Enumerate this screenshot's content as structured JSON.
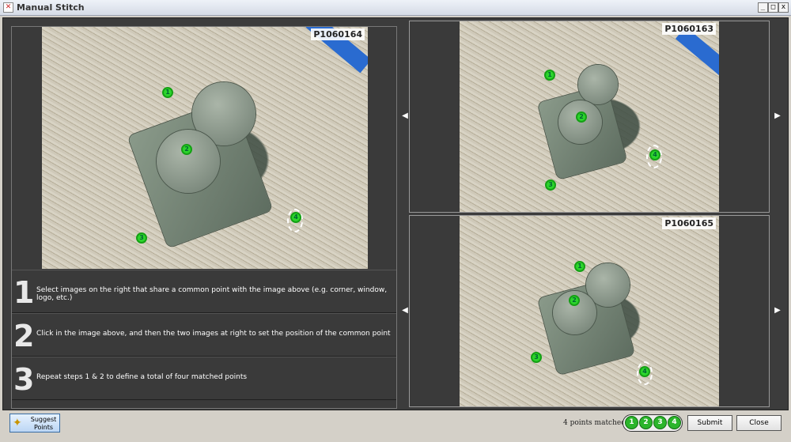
{
  "window": {
    "title": "Manual Stitch",
    "controls": {
      "minimize": "_",
      "maximize": "□",
      "close": "x"
    }
  },
  "main_image": {
    "label": "P1060164"
  },
  "steps": [
    {
      "number": "1",
      "text": "Select images on the right that share a common point with the image above (e.g. corner, window, logo, etc.)"
    },
    {
      "number": "2",
      "text": "Click in the image above, and then the two images at right to set the position of the common point"
    },
    {
      "number": "3",
      "text": "Repeat steps 1 & 2 to define a total of four matched points"
    }
  ],
  "thumbnails": [
    {
      "label": "P1060163"
    },
    {
      "label": "P1060165"
    }
  ],
  "marker_numbers": [
    "1",
    "2",
    "3",
    "4"
  ],
  "footer": {
    "suggest_label": "Suggest\nPoints",
    "matched_text": "4 points matched",
    "match_numbers": [
      "1",
      "2",
      "3",
      "4"
    ],
    "submit_label": "Submit",
    "close_label": "Close"
  }
}
